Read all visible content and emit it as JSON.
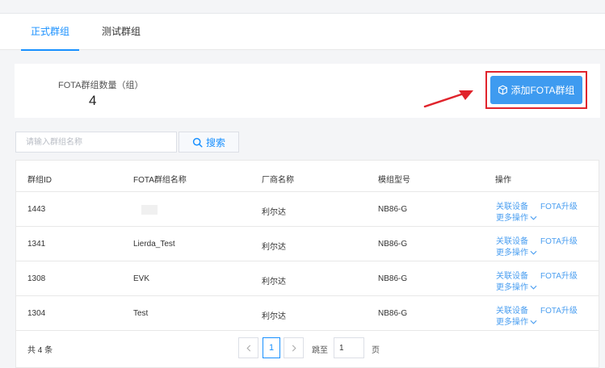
{
  "tabs": [
    {
      "label": "正式群组",
      "active": true
    },
    {
      "label": "测试群组",
      "active": false
    }
  ],
  "stats": {
    "label": "FOTA群组数量（组）",
    "value": "4"
  },
  "add_button": {
    "label": "添加FOTA群组",
    "icon": "cube-icon"
  },
  "search": {
    "placeholder": "请输入群组名称",
    "value": "",
    "button_label": "搜索"
  },
  "table": {
    "headers": [
      "群组ID",
      "FOTA群组名称",
      "厂商名称",
      "模组型号",
      "操作"
    ],
    "rows": [
      {
        "id": "1443",
        "name": "",
        "vendor": "利尔达",
        "model": "NB86-G"
      },
      {
        "id": "1341",
        "name": "Lierda_Test",
        "vendor": "利尔达",
        "model": "NB86-G"
      },
      {
        "id": "1308",
        "name": "EVK",
        "vendor": "利尔达",
        "model": "NB86-G"
      },
      {
        "id": "1304",
        "name": "Test",
        "vendor": "利尔达",
        "model": "NB86-G"
      }
    ],
    "actions": {
      "link_device": "关联设备",
      "fota_upgrade": "FOTA升级",
      "more": "更多操作"
    }
  },
  "pagination": {
    "total": "共 4 条",
    "current": "1",
    "jump_label": "跳至",
    "jump_value": "1",
    "page_unit": "页"
  },
  "colors": {
    "accent": "#1890ff",
    "button": "#3e9bf0",
    "highlight": "#e0242c"
  }
}
